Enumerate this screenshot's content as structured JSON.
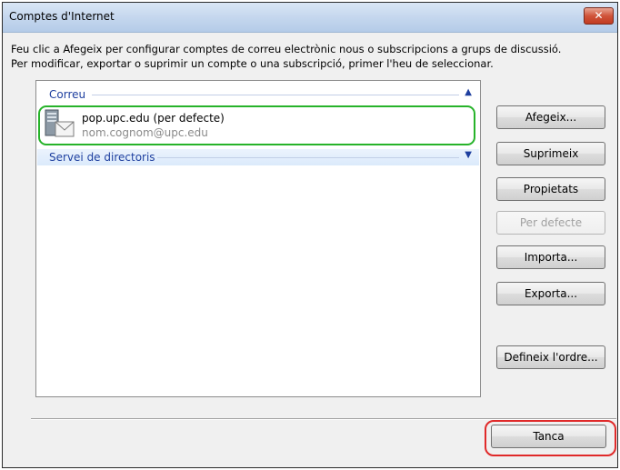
{
  "window": {
    "title": "Comptes d'Internet",
    "close_label": "✕"
  },
  "description": {
    "line1": "Feu clic a Afegeix per configurar comptes de correu electrònic nous o subscripcions a grups de discussió.",
    "line2": "Per modificar, exportar o suprimir un compte o una subscripció, primer l'heu de seleccionar."
  },
  "list": {
    "groups": [
      {
        "label": "Correu",
        "chevron": "▲"
      },
      {
        "label": "Servei de directoris",
        "chevron": "▼"
      }
    ],
    "account": {
      "name": "pop.upc.edu (per defecte)",
      "email": "nom.cognom@upc.edu",
      "icon": "mail-server-icon"
    }
  },
  "buttons": {
    "add": "Afegeix...",
    "remove": "Suprimeix",
    "properties": "Propietats",
    "default": "Per defecte",
    "import": "Importa...",
    "export": "Exporta...",
    "order": "Defineix l'ordre...",
    "close": "Tanca"
  },
  "colors": {
    "highlight_account": "#27b32a",
    "highlight_close": "#e02a2a",
    "group_text": "#1e3f9f"
  }
}
